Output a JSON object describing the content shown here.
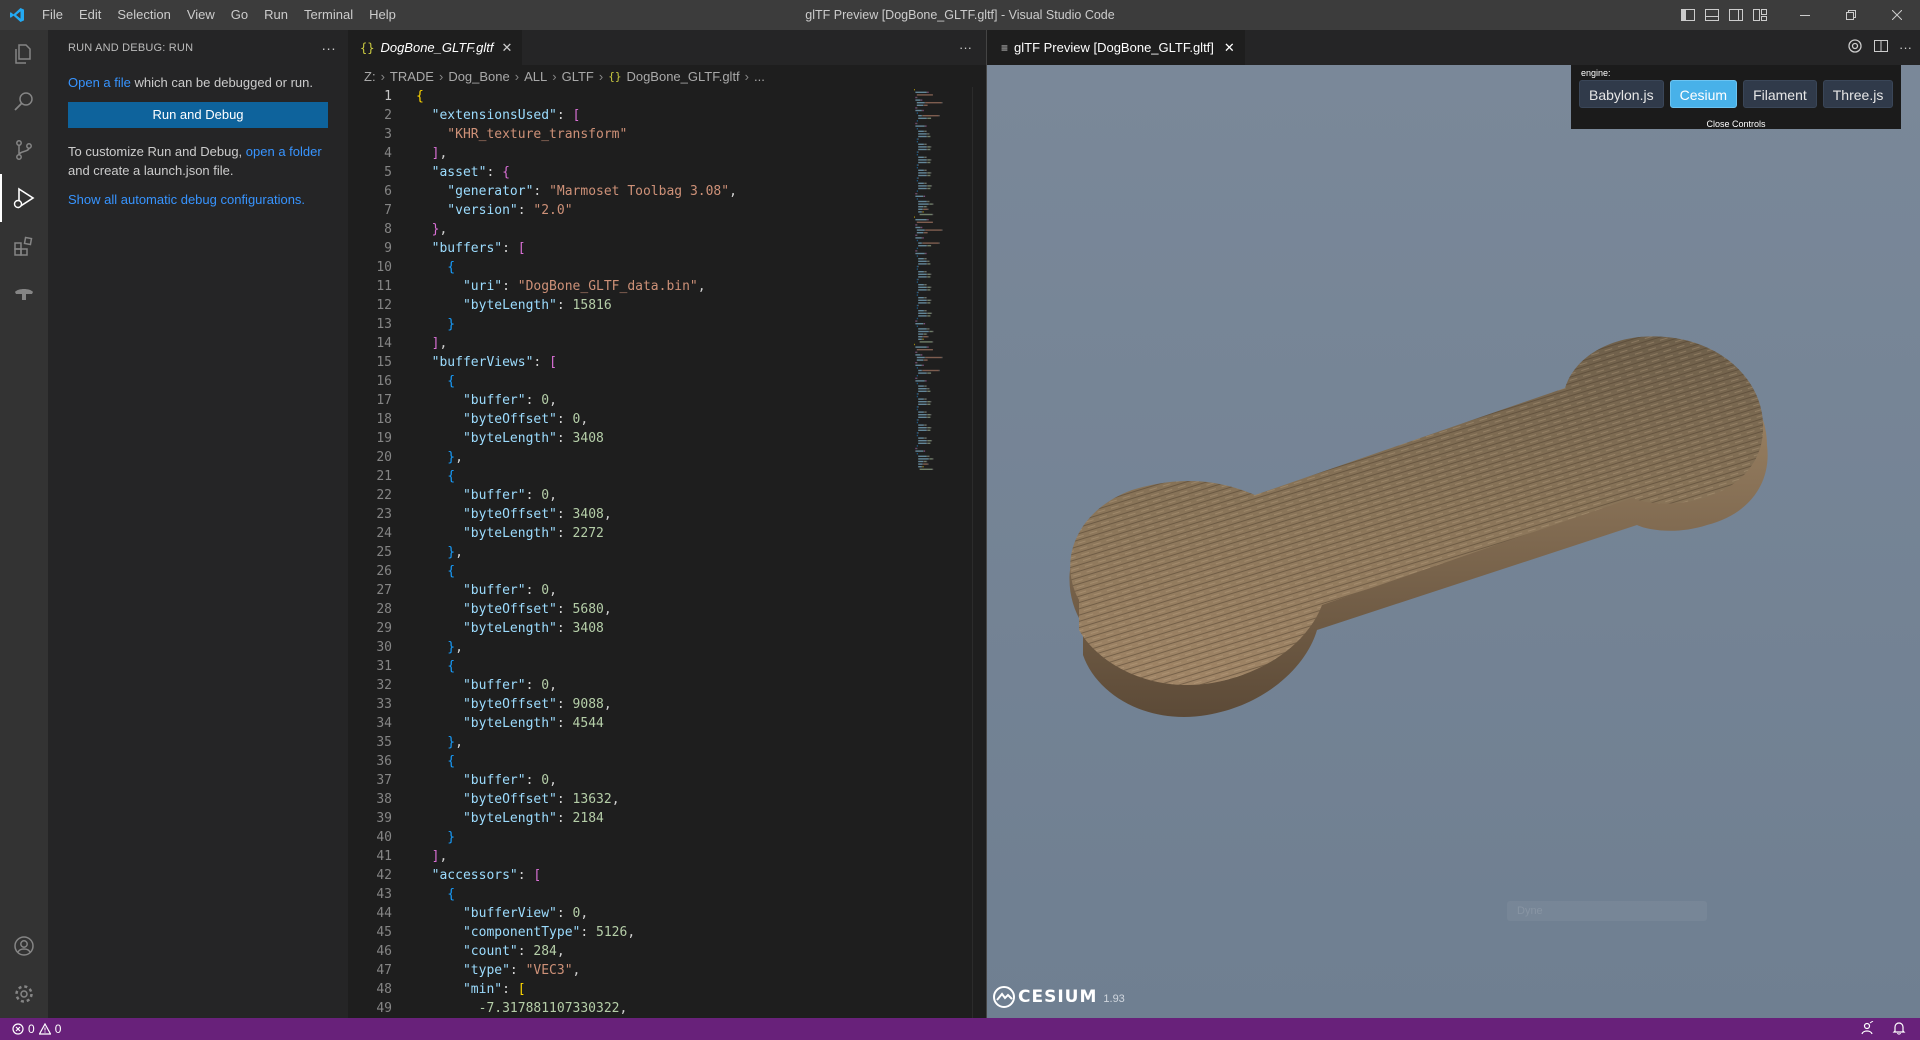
{
  "window": {
    "title": "glTF Preview [DogBone_GLTF.gltf] - Visual Studio Code"
  },
  "menu": [
    "File",
    "Edit",
    "Selection",
    "View",
    "Go",
    "Run",
    "Terminal",
    "Help"
  ],
  "sidebar": {
    "header": "RUN AND DEBUG: RUN",
    "open_file_link": "Open a file",
    "open_file_rest": " which can be debugged or run.",
    "run_button": "Run and Debug",
    "customize_text": "To customize Run and Debug, ",
    "open_folder_link": "open a folder",
    "customize_rest": " and create a launch.json file.",
    "show_all_link": "Show all automatic debug configurations."
  },
  "editor": {
    "tab_label": "DogBone_GLTF.gltf",
    "tab_icon": "{}",
    "breadcrumb": [
      "Z:",
      "TRADE",
      "Dog_Bone",
      "ALL",
      "GLTF",
      "DogBone_GLTF.gltf",
      "..."
    ]
  },
  "code_lines": [
    [
      [
        "b1",
        "{"
      ]
    ],
    [
      [
        "k",
        "  \"extensionsUsed\""
      ],
      [
        "p",
        ": "
      ],
      [
        "b2",
        "["
      ]
    ],
    [
      [
        "s",
        "    \"KHR_texture_transform\""
      ]
    ],
    [
      [
        "b2",
        "  ]"
      ],
      [
        "p",
        ","
      ]
    ],
    [
      [
        "k",
        "  \"asset\""
      ],
      [
        "p",
        ": "
      ],
      [
        "b2",
        "{"
      ]
    ],
    [
      [
        "k",
        "    \"generator\""
      ],
      [
        "p",
        ": "
      ],
      [
        "s",
        "\"Marmoset Toolbag 3.08\""
      ],
      [
        "p",
        ","
      ]
    ],
    [
      [
        "k",
        "    \"version\""
      ],
      [
        "p",
        ": "
      ],
      [
        "s",
        "\"2.0\""
      ]
    ],
    [
      [
        "b2",
        "  }"
      ],
      [
        "p",
        ","
      ]
    ],
    [
      [
        "k",
        "  \"buffers\""
      ],
      [
        "p",
        ": "
      ],
      [
        "b2",
        "["
      ]
    ],
    [
      [
        "b3",
        "    {"
      ]
    ],
    [
      [
        "k",
        "      \"uri\""
      ],
      [
        "p",
        ": "
      ],
      [
        "s",
        "\"DogBone_GLTF_data.bin\""
      ],
      [
        "p",
        ","
      ]
    ],
    [
      [
        "k",
        "      \"byteLength\""
      ],
      [
        "p",
        ": "
      ],
      [
        "n",
        "15816"
      ]
    ],
    [
      [
        "b3",
        "    }"
      ]
    ],
    [
      [
        "b2",
        "  ]"
      ],
      [
        "p",
        ","
      ]
    ],
    [
      [
        "k",
        "  \"bufferViews\""
      ],
      [
        "p",
        ": "
      ],
      [
        "b2",
        "["
      ]
    ],
    [
      [
        "b3",
        "    {"
      ]
    ],
    [
      [
        "k",
        "      \"buffer\""
      ],
      [
        "p",
        ": "
      ],
      [
        "n",
        "0"
      ],
      [
        "p",
        ","
      ]
    ],
    [
      [
        "k",
        "      \"byteOffset\""
      ],
      [
        "p",
        ": "
      ],
      [
        "n",
        "0"
      ],
      [
        "p",
        ","
      ]
    ],
    [
      [
        "k",
        "      \"byteLength\""
      ],
      [
        "p",
        ": "
      ],
      [
        "n",
        "3408"
      ]
    ],
    [
      [
        "b3",
        "    }"
      ],
      [
        "p",
        ","
      ]
    ],
    [
      [
        "b3",
        "    {"
      ]
    ],
    [
      [
        "k",
        "      \"buffer\""
      ],
      [
        "p",
        ": "
      ],
      [
        "n",
        "0"
      ],
      [
        "p",
        ","
      ]
    ],
    [
      [
        "k",
        "      \"byteOffset\""
      ],
      [
        "p",
        ": "
      ],
      [
        "n",
        "3408"
      ],
      [
        "p",
        ","
      ]
    ],
    [
      [
        "k",
        "      \"byteLength\""
      ],
      [
        "p",
        ": "
      ],
      [
        "n",
        "2272"
      ]
    ],
    [
      [
        "b3",
        "    }"
      ],
      [
        "p",
        ","
      ]
    ],
    [
      [
        "b3",
        "    {"
      ]
    ],
    [
      [
        "k",
        "      \"buffer\""
      ],
      [
        "p",
        ": "
      ],
      [
        "n",
        "0"
      ],
      [
        "p",
        ","
      ]
    ],
    [
      [
        "k",
        "      \"byteOffset\""
      ],
      [
        "p",
        ": "
      ],
      [
        "n",
        "5680"
      ],
      [
        "p",
        ","
      ]
    ],
    [
      [
        "k",
        "      \"byteLength\""
      ],
      [
        "p",
        ": "
      ],
      [
        "n",
        "3408"
      ]
    ],
    [
      [
        "b3",
        "    }"
      ],
      [
        "p",
        ","
      ]
    ],
    [
      [
        "b3",
        "    {"
      ]
    ],
    [
      [
        "k",
        "      \"buffer\""
      ],
      [
        "p",
        ": "
      ],
      [
        "n",
        "0"
      ],
      [
        "p",
        ","
      ]
    ],
    [
      [
        "k",
        "      \"byteOffset\""
      ],
      [
        "p",
        ": "
      ],
      [
        "n",
        "9088"
      ],
      [
        "p",
        ","
      ]
    ],
    [
      [
        "k",
        "      \"byteLength\""
      ],
      [
        "p",
        ": "
      ],
      [
        "n",
        "4544"
      ]
    ],
    [
      [
        "b3",
        "    }"
      ],
      [
        "p",
        ","
      ]
    ],
    [
      [
        "b3",
        "    {"
      ]
    ],
    [
      [
        "k",
        "      \"buffer\""
      ],
      [
        "p",
        ": "
      ],
      [
        "n",
        "0"
      ],
      [
        "p",
        ","
      ]
    ],
    [
      [
        "k",
        "      \"byteOffset\""
      ],
      [
        "p",
        ": "
      ],
      [
        "n",
        "13632"
      ],
      [
        "p",
        ","
      ]
    ],
    [
      [
        "k",
        "      \"byteLength\""
      ],
      [
        "p",
        ": "
      ],
      [
        "n",
        "2184"
      ]
    ],
    [
      [
        "b3",
        "    }"
      ]
    ],
    [
      [
        "b2",
        "  ]"
      ],
      [
        "p",
        ","
      ]
    ],
    [
      [
        "k",
        "  \"accessors\""
      ],
      [
        "p",
        ": "
      ],
      [
        "b2",
        "["
      ]
    ],
    [
      [
        "b3",
        "    {"
      ]
    ],
    [
      [
        "k",
        "      \"bufferView\""
      ],
      [
        "p",
        ": "
      ],
      [
        "n",
        "0"
      ],
      [
        "p",
        ","
      ]
    ],
    [
      [
        "k",
        "      \"componentType\""
      ],
      [
        "p",
        ": "
      ],
      [
        "n",
        "5126"
      ],
      [
        "p",
        ","
      ]
    ],
    [
      [
        "k",
        "      \"count\""
      ],
      [
        "p",
        ": "
      ],
      [
        "n",
        "284"
      ],
      [
        "p",
        ","
      ]
    ],
    [
      [
        "k",
        "      \"type\""
      ],
      [
        "p",
        ": "
      ],
      [
        "s",
        "\"VEC3\""
      ],
      [
        "p",
        ","
      ]
    ],
    [
      [
        "k",
        "      \"min\""
      ],
      [
        "p",
        ": "
      ],
      [
        "b1",
        "["
      ]
    ],
    [
      [
        "n",
        "        -7.317881107330322"
      ],
      [
        "p",
        ","
      ]
    ]
  ],
  "preview": {
    "tab_label": "glTF Preview [DogBone_GLTF.gltf]",
    "engine_label": "engine:",
    "engines": [
      "Babylon.js",
      "Cesium",
      "Filament",
      "Three.js"
    ],
    "selected_engine": "Cesium",
    "close_controls": "Close Controls",
    "cesium_logo": "CESIUM",
    "cesium_version": "1.93",
    "faint_overlay": "Dyne"
  },
  "status": {
    "errors": "0",
    "warnings": "0"
  },
  "colors": {
    "statusbar": "#68217a",
    "accent_button": "#0e639c",
    "selected_engine": "#48b1e9"
  }
}
